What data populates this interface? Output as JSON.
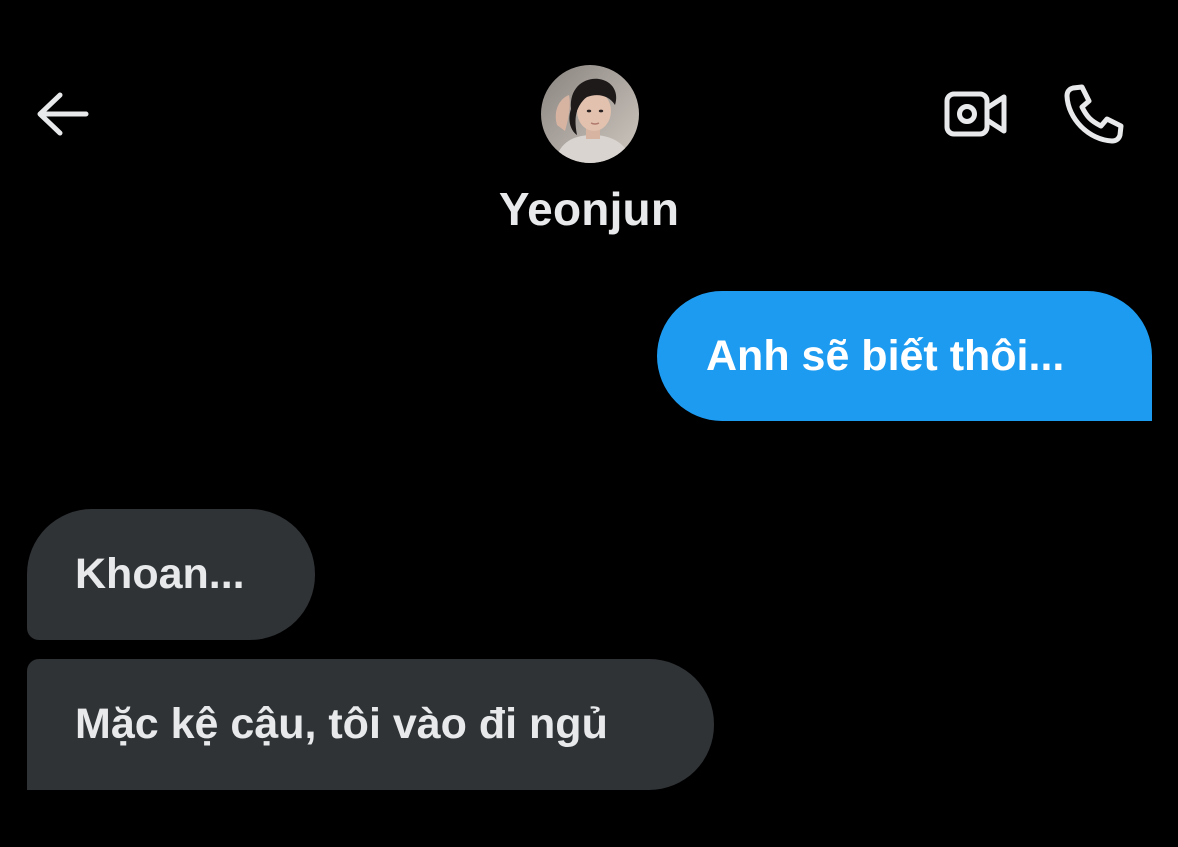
{
  "header": {
    "back_icon": "arrow-left-icon",
    "video_icon": "video-camera-icon",
    "call_icon": "phone-icon",
    "contact_name": "Yeonjun"
  },
  "messages": [
    {
      "side": "sent",
      "text": "Anh sẽ biết thôi..."
    },
    {
      "side": "received",
      "text": "Khoan..."
    },
    {
      "side": "received",
      "text": "Mặc kệ cậu, tôi vào đi ngủ"
    }
  ],
  "colors": {
    "background": "#000000",
    "sent_bubble": "#1d9bf0",
    "received_bubble": "#2f3336",
    "text_primary": "#e7e9ea",
    "icon": "#e7e9ea"
  }
}
